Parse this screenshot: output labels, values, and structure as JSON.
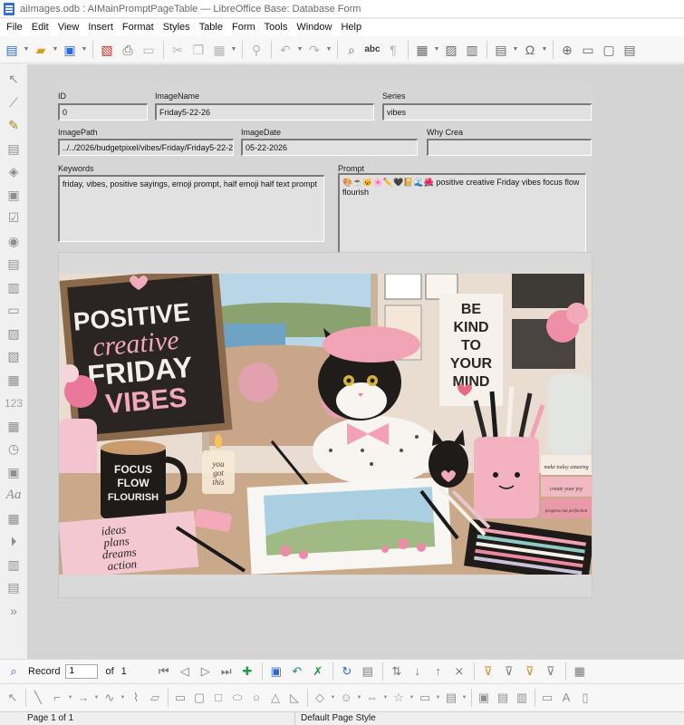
{
  "window": {
    "title": "aiImages.odb : AIMainPromptPageTable — LibreOffice Base: Database Form"
  },
  "menu": [
    "File",
    "Edit",
    "View",
    "Insert",
    "Format",
    "Styles",
    "Table",
    "Form",
    "Tools",
    "Window",
    "Help"
  ],
  "toolbar": {
    "spelling_label": "abc"
  },
  "left_toolbar": {
    "numeric_label": "123",
    "font_label": "Aa"
  },
  "form": {
    "id": {
      "label": "ID",
      "value": "0"
    },
    "image_name": {
      "label": "ImageName",
      "value": "Friday5-22-26"
    },
    "series": {
      "label": "Series",
      "value": "vibes"
    },
    "image_path": {
      "label": "ImagePath",
      "value": "../../2026/budgetpixel/vibes/Friday/Friday5-22-26.png"
    },
    "image_date": {
      "label": "ImageDate",
      "value": "05-22-2026"
    },
    "why_created": {
      "label": "Why Crea",
      "value": ""
    },
    "keywords": {
      "label": "Keywords",
      "value": "friday, vibes, positive sayings, emoji prompt, half emoji half text prompt"
    },
    "prompt": {
      "label": "Prompt",
      "value": "🎨☕🐱🌸✏️🖤📔🌊🌺 positive creative Friday vibes focus flow flourish"
    }
  },
  "image": {
    "chalkboard_lines": [
      "POSITIVE",
      "creative",
      "FRIDAY",
      "VIBES"
    ],
    "sign_lines": [
      "BE",
      "KIND",
      "TO",
      "YOUR",
      "MIND"
    ],
    "mug_lines": [
      "FOCUS",
      "FLOW",
      "FLOURISH"
    ],
    "candle_lines": [
      "you",
      "got",
      "this"
    ],
    "notebook_lines": [
      "ideas",
      "plans",
      "dreams",
      "action"
    ],
    "book_spines": [
      "make today amazing",
      "create your joy",
      "progress not perfection"
    ],
    "colors": {
      "chalkboard": "#2a2522",
      "pink": "#f2a9b9",
      "beret": "#f0a4b4",
      "sea": "#6fa3c3"
    }
  },
  "navigation": {
    "record_label": "Record",
    "record_value": "1",
    "of_label": "of",
    "total": "1"
  },
  "status": {
    "page": "Page 1 of 1",
    "style": "Default Page Style"
  }
}
